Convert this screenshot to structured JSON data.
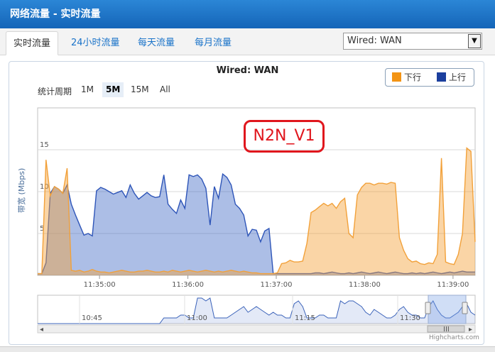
{
  "window": {
    "title": "网络流量 - 实时流量"
  },
  "tabs": [
    {
      "label": "实时流量",
      "active": true
    },
    {
      "label": "24小时流量",
      "active": false
    },
    {
      "label": "每天流量",
      "active": false
    },
    {
      "label": "每月流量",
      "active": false
    }
  ],
  "interface_select": {
    "value": "Wired: WAN"
  },
  "range_selector": {
    "label": "统计周期",
    "buttons": [
      {
        "label": "1M",
        "selected": false
      },
      {
        "label": "5M",
        "selected": true
      },
      {
        "label": "15M",
        "selected": false
      },
      {
        "label": "All",
        "selected": false
      }
    ]
  },
  "overlay_label": "N2N_V1",
  "credits": "Highcharts.com",
  "chart_data": {
    "type": "area",
    "title": "Wired: WAN",
    "ylabel": "带宽 (Mbps)",
    "yticks": [
      "5",
      "10",
      "15"
    ],
    "xticks": [
      "11:35:00",
      "11:36:00",
      "11:37:00",
      "11:38:00",
      "11:39:00"
    ],
    "ylim": [
      0,
      20
    ],
    "x_range": [
      "11:34:18",
      "11:39:15"
    ],
    "legend": {
      "placement": "top-right"
    },
    "navigator_ticks": [
      "10:45",
      "11:00",
      "11:15",
      "11:30"
    ],
    "series": [
      {
        "name": "下行",
        "color": "#f2a13a",
        "values": [
          0.2,
          0.2,
          13.8,
          9.5,
          10.6,
          10.3,
          9.8,
          12.8,
          0.6,
          0.5,
          0.6,
          0.4,
          0.5,
          0.7,
          0.5,
          0.4,
          0.4,
          0.3,
          0.4,
          0.5,
          0.6,
          0.5,
          0.4,
          0.4,
          0.5,
          0.5,
          0.6,
          0.5,
          0.4,
          0.4,
          0.5,
          0.4,
          0.6,
          0.5,
          0.4,
          0.5,
          0.6,
          0.5,
          0.4,
          0.5,
          0.6,
          0.5,
          0.4,
          0.5,
          0.4,
          0.5,
          0.6,
          0.5,
          0.4,
          0.5,
          0.4,
          0.3,
          0.3,
          0.2,
          0.2,
          0.2,
          0.2,
          0.3,
          1.4,
          1.5,
          1.8,
          1.6,
          1.6,
          1.7,
          3.8,
          7.5,
          7.8,
          8.2,
          8.6,
          8.3,
          8.6,
          8.0,
          8.8,
          9.2,
          5.0,
          4.5,
          9.6,
          10.5,
          11.0,
          11.0,
          10.8,
          11.0,
          11.0,
          10.9,
          11.1,
          11.0,
          4.5,
          3.0,
          2.0,
          1.6,
          1.7,
          1.4,
          1.3,
          1.5,
          1.4,
          2.5,
          14.0,
          1.6,
          1.4,
          1.3,
          2.5,
          5.0,
          15.2,
          14.8,
          4.0
        ]
      },
      {
        "name": "上行",
        "color": "#2e55b8",
        "values": [
          0.2,
          0.2,
          1.5,
          9.8,
          10.6,
          10.3,
          9.8,
          10.8,
          8.5,
          7.2,
          6.0,
          4.8,
          5.0,
          4.7,
          10.1,
          10.5,
          10.3,
          10.0,
          9.7,
          9.9,
          10.1,
          9.3,
          10.8,
          9.8,
          9.1,
          9.5,
          9.9,
          9.5,
          9.3,
          9.4,
          12.0,
          8.5,
          7.9,
          7.4,
          9.0,
          8.0,
          12.0,
          11.8,
          12.0,
          11.5,
          10.4,
          6.0,
          10.6,
          9.2,
          12.1,
          11.7,
          10.8,
          8.5,
          8.0,
          7.2,
          4.7,
          5.5,
          5.4,
          4.0,
          5.3,
          5.6,
          0.2,
          0.2,
          0.2,
          0.2,
          0.2,
          0.2,
          0.2,
          0.2,
          0.2,
          0.2,
          0.3,
          0.3,
          0.2,
          0.3,
          0.4,
          0.3,
          0.2,
          0.2,
          0.3,
          0.2,
          0.3,
          0.4,
          0.3,
          0.2,
          0.3,
          0.4,
          0.3,
          0.2,
          0.3,
          0.4,
          0.3,
          0.2,
          0.2,
          0.3,
          0.2,
          0.3,
          0.2,
          0.3,
          0.4,
          0.3,
          0.2,
          0.3,
          0.4,
          0.3,
          0.4,
          0.5,
          0.4,
          0.4,
          0.4
        ]
      }
    ]
  }
}
